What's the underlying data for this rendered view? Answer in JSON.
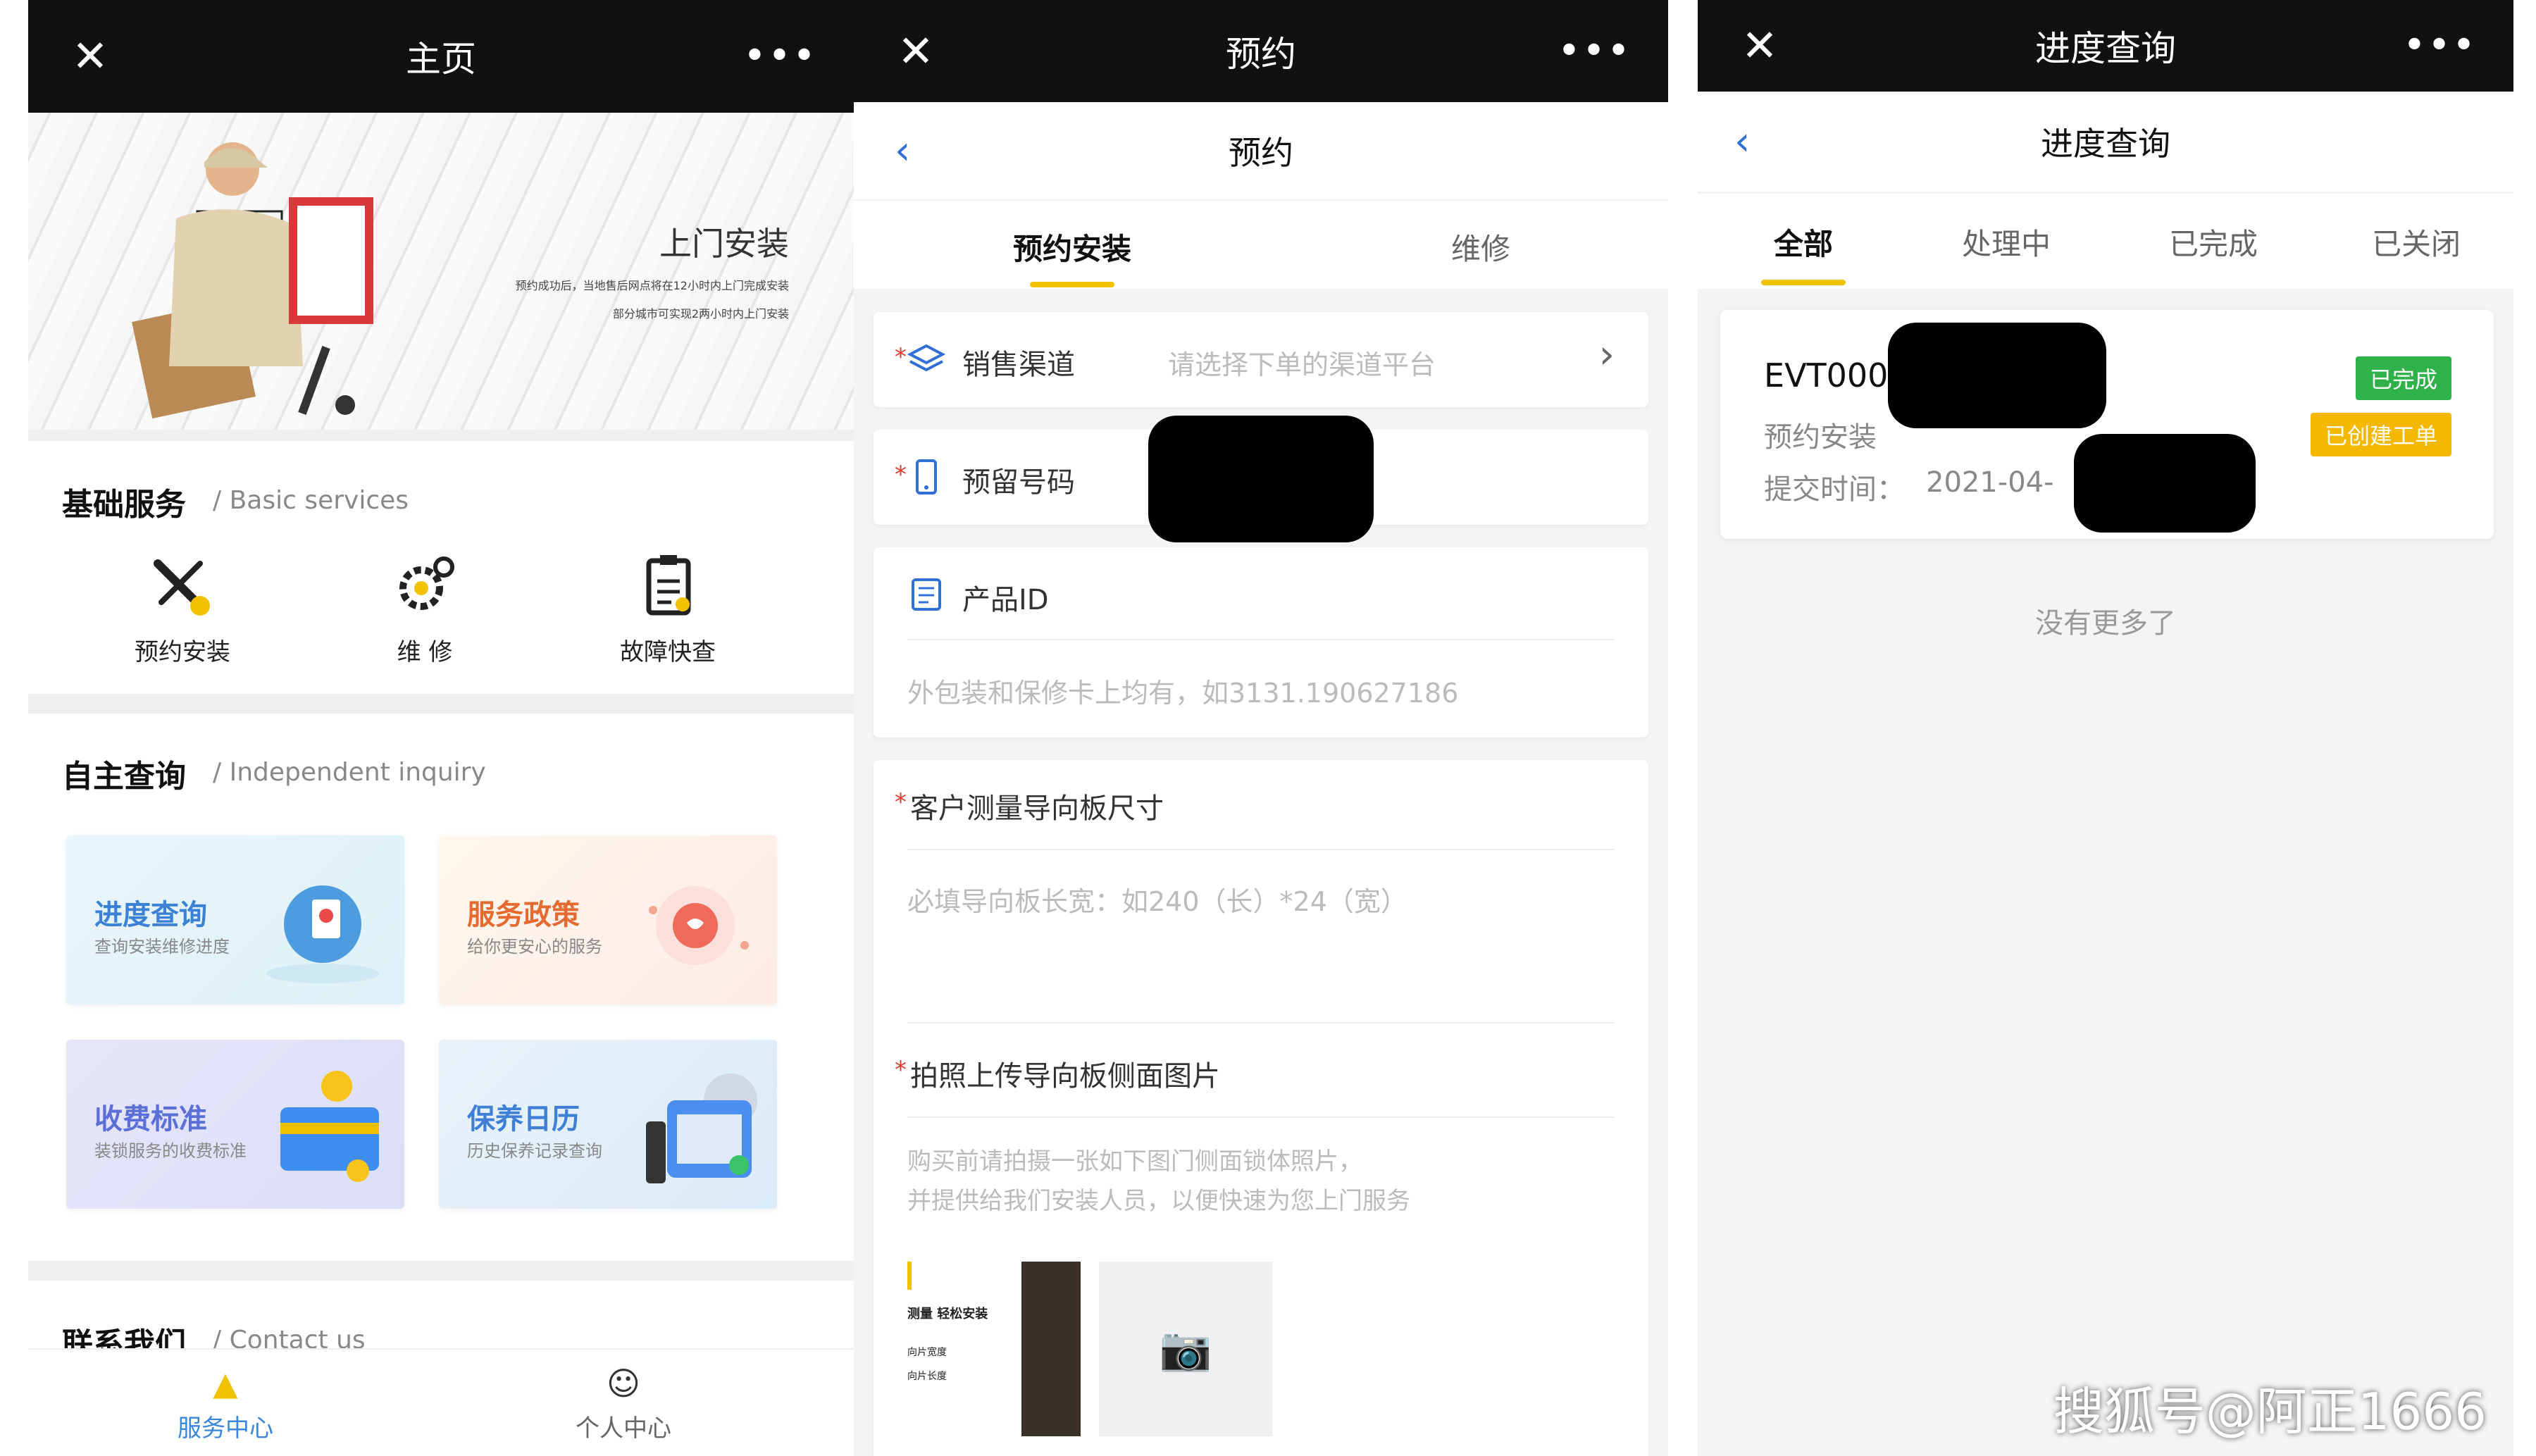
{
  "panel_home": {
    "title": "主页",
    "hero": {
      "title": "上门安装",
      "line1": "预约成功后，当地售后网点将在12小时内上门完成安装",
      "line2": "部分城市可实现2两小时内上门安装"
    },
    "basic": {
      "title": "基础服务",
      "subtitle": "/ Basic services",
      "items": [
        {
          "label": "预约安装",
          "icon": "wrench-screwdriver-icon"
        },
        {
          "label": "维 修",
          "icon": "gear-icon"
        },
        {
          "label": "故障快查",
          "icon": "clipboard-icon"
        }
      ]
    },
    "inquiry": {
      "title": "自主查询",
      "subtitle": "/ Independent inquiry",
      "cards": [
        {
          "title": "进度查询",
          "desc": "查询安装维修进度",
          "color": "#3b82d6"
        },
        {
          "title": "服务政策",
          "desc": "给你更安心的服务",
          "color": "#e56a2f"
        },
        {
          "title": "收费标准",
          "desc": "装锁服务的收费标准",
          "color": "#5b6fd8"
        },
        {
          "title": "保养日历",
          "desc": "历史保养记录查询",
          "color": "#3f7fd6"
        }
      ]
    },
    "contact": {
      "title": "联系我们",
      "subtitle": "/ Contact us"
    },
    "nav": [
      {
        "label": "服务中心",
        "icon": "warning-triangle-icon",
        "active": true
      },
      {
        "label": "个人中心",
        "icon": "smiley-icon",
        "active": false
      }
    ]
  },
  "panel_booking": {
    "title": "预约",
    "subtitle": "预约",
    "tabs": [
      "预约安装",
      "维修"
    ],
    "channel": {
      "label": "销售渠道",
      "placeholder": "请选择下单的渠道平台"
    },
    "phone": {
      "label": "预留号码"
    },
    "product": {
      "label": "产品ID",
      "placeholder": "外包装和保修卡上均有，如3131.190627186"
    },
    "size": {
      "label": "客户测量导向板尺寸",
      "placeholder": "必填导向板长宽：如240（长）*24（宽）"
    },
    "photo": {
      "label": "拍照上传导向板侧面图片",
      "hint1": "购买前请拍摄一张如下图门侧面锁体照片，",
      "hint2": "并提供给我们安装人员，以便快速为您上门服务",
      "sample1": "测量 轻松安装",
      "sample2": "向片宽度",
      "sample3": "向片长度"
    }
  },
  "panel_progress": {
    "title": "进度查询",
    "subtitle": "进度查询",
    "tabs": [
      "全部",
      "处理中",
      "已完成",
      "已关闭"
    ],
    "order": {
      "id": "EVT000",
      "type": "预约安装",
      "time_label": "提交时间：",
      "time": "2021-04-",
      "badge_done": "已完成",
      "badge_created": "已创建工单",
      "done_color": "#2fb24a",
      "created_color": "#f5b800"
    },
    "no_more": "没有更多了"
  },
  "watermark": "搜狐号@阿正1666"
}
